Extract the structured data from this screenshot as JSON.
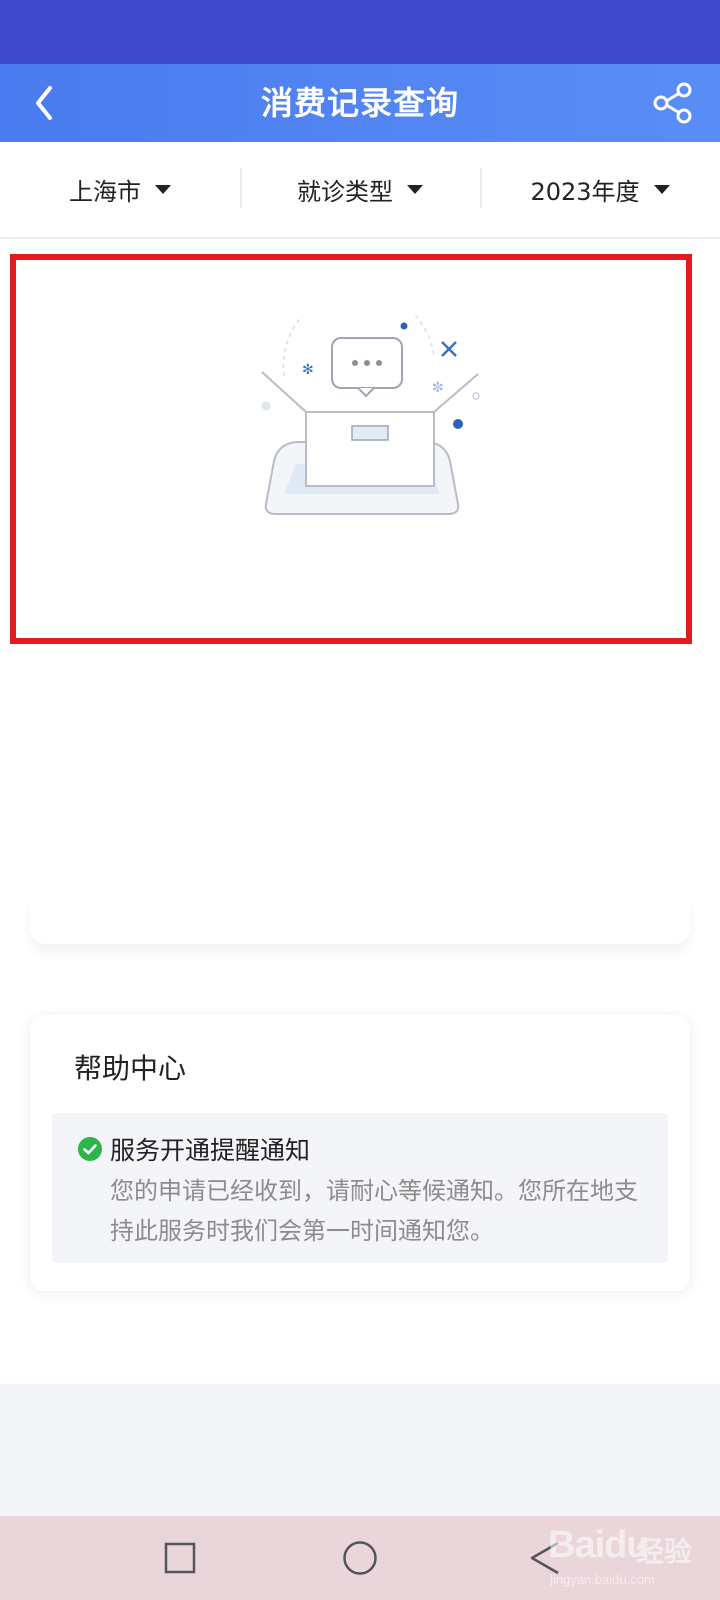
{
  "header": {
    "title": "消费记录查询",
    "back_icon": "chevron-left-icon",
    "share_icon": "share-icon",
    "background_color": "#3f48cc",
    "accent_color": "#4a7bf0"
  },
  "filters": [
    {
      "label": "上海市",
      "icon": "caret-down-icon"
    },
    {
      "label": "就诊类型",
      "icon": "caret-down-icon"
    },
    {
      "label": "2023年度",
      "icon": "caret-down-icon"
    }
  ],
  "empty_state": {
    "illustration": "empty-box-illustration",
    "highlight_color": "#e01b22"
  },
  "help_center": {
    "title": "帮助中心",
    "notice": {
      "icon": "check-circle-icon",
      "icon_color": "#2db44a",
      "title": "服务开通提醒通知",
      "body": "您的申请已经收到，请耐心等候通知。您所在地支持此服务时我们会第一时间通知您。"
    }
  },
  "system_nav": {
    "buttons": [
      "recent-apps-icon",
      "home-icon",
      "back-icon"
    ]
  },
  "watermark": {
    "brand": "Baidu",
    "brand_cn": "经验",
    "url": "jingyan.baidu.com"
  }
}
